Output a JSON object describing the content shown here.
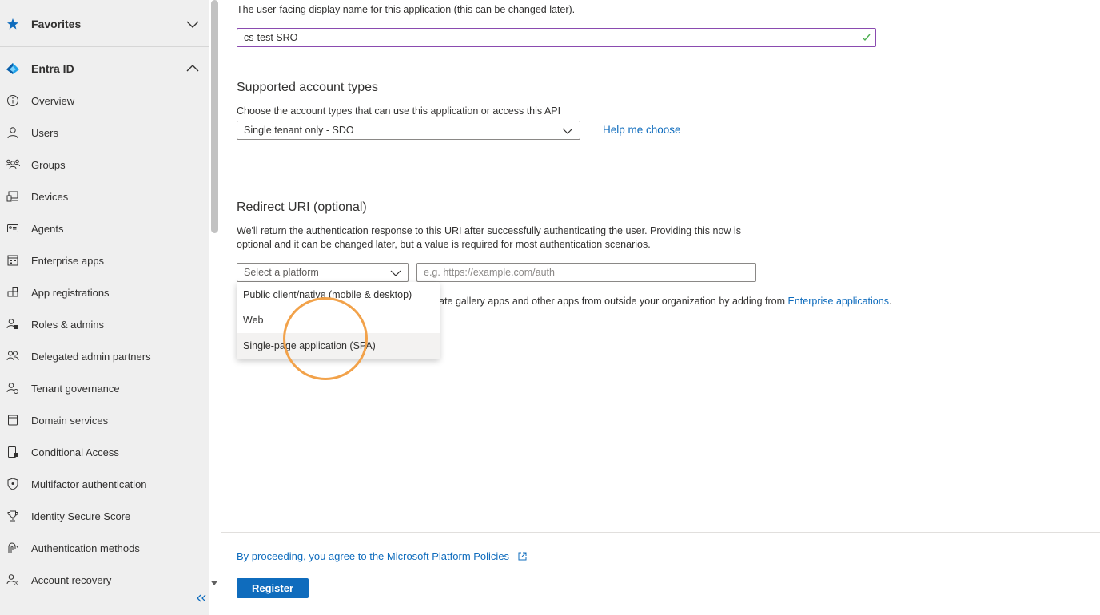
{
  "sidebar": {
    "favorites_label": "Favorites",
    "section_label": "Entra ID",
    "items": [
      {
        "label": "Overview",
        "icon": "info-icon"
      },
      {
        "label": "Users",
        "icon": "user-icon"
      },
      {
        "label": "Groups",
        "icon": "groups-icon"
      },
      {
        "label": "Devices",
        "icon": "devices-icon"
      },
      {
        "label": "Agents",
        "icon": "agents-icon"
      },
      {
        "label": "Enterprise apps",
        "icon": "enterprise-apps-icon"
      },
      {
        "label": "App registrations",
        "icon": "app-registrations-icon"
      },
      {
        "label": "Roles & admins",
        "icon": "roles-icon"
      },
      {
        "label": "Delegated admin partners",
        "icon": "delegated-admin-icon"
      },
      {
        "label": "Tenant governance",
        "icon": "tenant-governance-icon"
      },
      {
        "label": "Domain services",
        "icon": "domain-services-icon"
      },
      {
        "label": "Conditional Access",
        "icon": "conditional-access-icon"
      },
      {
        "label": "Multifactor authentication",
        "icon": "shield-icon"
      },
      {
        "label": "Identity Secure Score",
        "icon": "trophy-icon"
      },
      {
        "label": "Authentication methods",
        "icon": "auth-methods-icon"
      },
      {
        "label": "Account recovery",
        "icon": "account-recovery-icon"
      }
    ],
    "collapse_icon": "double-chevron-left-icon"
  },
  "form": {
    "name_description": "The user-facing display name for this application (this can be changed later).",
    "name_value": "cs-test SRO",
    "account_types_title": "Supported account types",
    "account_types_description": "Choose the account types that can use this application or access this API",
    "account_types_value": "Single tenant only - SDO",
    "help_link": "Help me choose",
    "redirect_title": "Redirect URI (optional)",
    "redirect_description_1": "We'll return the authentication response to this URI after successfully authenticating the user. Providing this now is",
    "redirect_description_2": "optional and it can be changed later, but a value is required for most authentication scenarios.",
    "platform_placeholder": "Select a platform",
    "uri_placeholder": "e.g. https://example.com/auth",
    "platform_options": [
      "Public client/native (mobile & desktop)",
      "Web",
      "Single-page application (SPA)"
    ],
    "gallery_text": "grate gallery apps and other apps from outside your organization by adding from ",
    "gallery_link": "Enterprise applications",
    "gallery_period": "."
  },
  "footer": {
    "policy_link": "By proceeding, you agree to the Microsoft Platform Policies",
    "register_label": "Register"
  },
  "colors": {
    "accent": "#0f6cbd",
    "valid_check": "#4caf50",
    "input_focus_border": "#8a4bb0",
    "highlight": "#f2a24a"
  }
}
